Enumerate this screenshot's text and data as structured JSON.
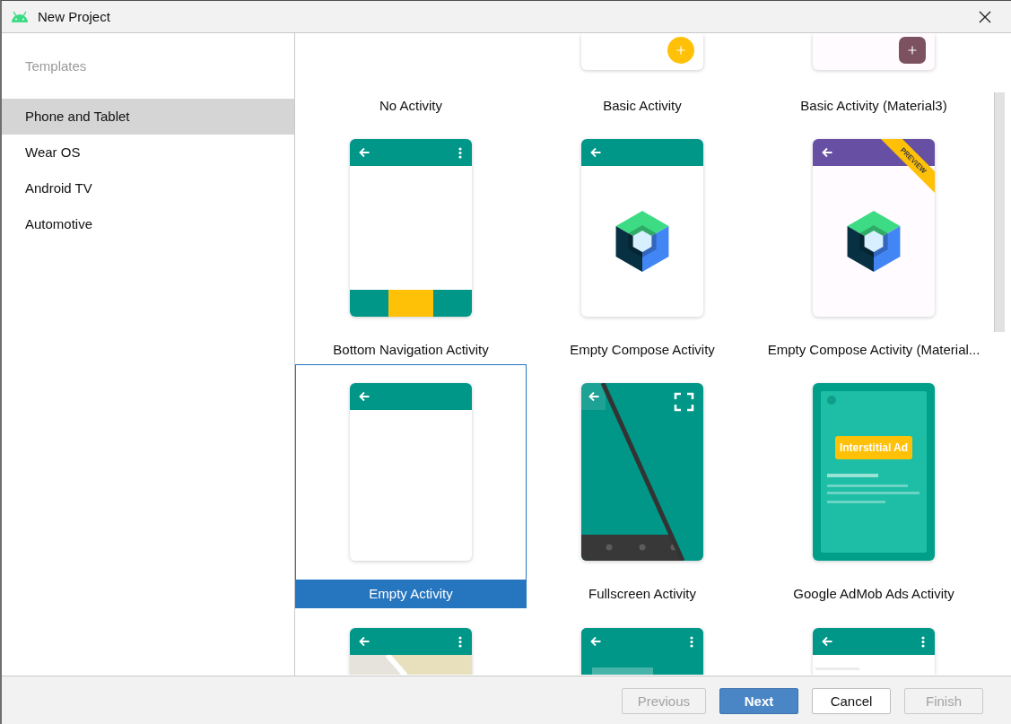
{
  "window": {
    "title": "New Project"
  },
  "sidebar": {
    "heading": "Templates",
    "items": [
      {
        "label": "Phone and Tablet",
        "selected": true
      },
      {
        "label": "Wear OS",
        "selected": false
      },
      {
        "label": "Android TV",
        "selected": false
      },
      {
        "label": "Automotive",
        "selected": false
      }
    ]
  },
  "templates": [
    {
      "name": "No Activity",
      "kind": "blank",
      "selected": false
    },
    {
      "name": "Basic Activity",
      "kind": "fab",
      "selected": false
    },
    {
      "name": "Basic Activity (Material3)",
      "kind": "fab-square",
      "selected": false
    },
    {
      "name": "Bottom Navigation Activity",
      "kind": "bottom-nav",
      "selected": false
    },
    {
      "name": "Empty Compose Activity",
      "kind": "compose",
      "selected": false
    },
    {
      "name": "Empty Compose Activity (Material...",
      "kind": "compose-ribbon",
      "ribbon": "PREVIEW",
      "selected": false
    },
    {
      "name": "Empty Activity",
      "kind": "empty",
      "selected": true
    },
    {
      "name": "Fullscreen Activity",
      "kind": "fullscreen",
      "selected": false
    },
    {
      "name": "Google AdMob Ads Activity",
      "kind": "interstitial-ad",
      "ad_label": "Interstitial Ad",
      "selected": false
    },
    {
      "kind": "map",
      "selected": false
    },
    {
      "kind": "panel",
      "selected": false
    },
    {
      "kind": "list",
      "selected": false
    }
  ],
  "buttons": [
    {
      "label": "Previous",
      "kind": "default",
      "disabled": true
    },
    {
      "label": "Next",
      "kind": "primary",
      "disabled": false
    },
    {
      "label": "Cancel",
      "kind": "default",
      "disabled": false
    },
    {
      "label": "Finish",
      "kind": "default",
      "disabled": true
    }
  ]
}
